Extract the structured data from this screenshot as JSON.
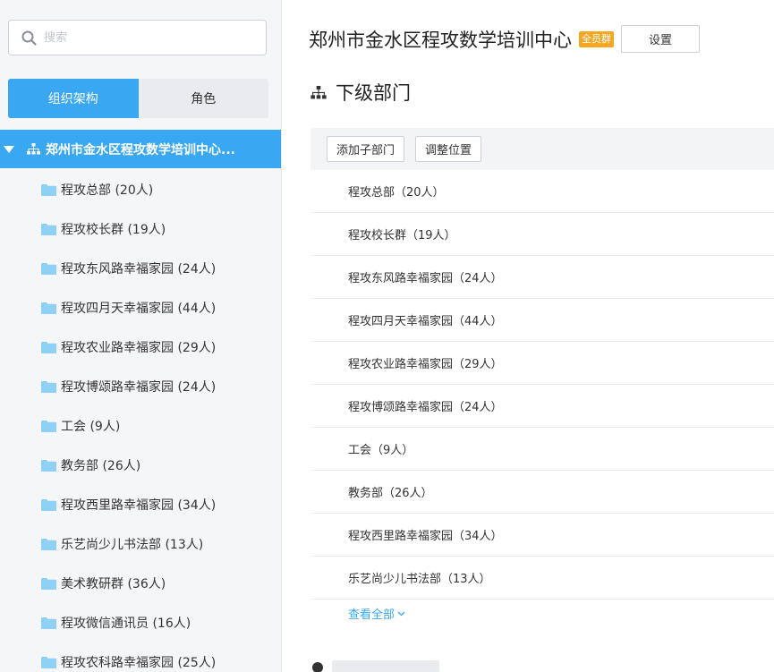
{
  "sidebar": {
    "search_placeholder": "搜索",
    "tabs": [
      {
        "label": "组织架构",
        "active": true
      },
      {
        "label": "角色",
        "active": false
      }
    ],
    "root": {
      "name": "郑州市金水区程攻数学培训中心..."
    },
    "items": [
      {
        "label": "程攻总部 (20人)"
      },
      {
        "label": "程攻校长群 (19人)"
      },
      {
        "label": "程攻东风路幸福家园 (24人)"
      },
      {
        "label": "程攻四月天幸福家园 (44人)"
      },
      {
        "label": "程攻农业路幸福家园 (29人)"
      },
      {
        "label": "程攻博颂路幸福家园 (24人)"
      },
      {
        "label": "工会 (9人)"
      },
      {
        "label": "教务部 (26人)"
      },
      {
        "label": "程攻西里路幸福家园 (34人)"
      },
      {
        "label": "乐艺尚少儿书法部 (13人)"
      },
      {
        "label": "美术教研群 (36人)"
      },
      {
        "label": "程攻微信通讯员 (16人)"
      },
      {
        "label": "程攻农科路幸福家园 (25人)"
      }
    ]
  },
  "main": {
    "title": "郑州市金水区程攻数学培训中心",
    "badge": "全员群",
    "settings_label": "设置",
    "section_title": "下级部门",
    "toolbar": {
      "add_child_label": "添加子部门",
      "adjust_position_label": "调整位置"
    },
    "departments": [
      {
        "label": "程攻总部（20人）"
      },
      {
        "label": "程攻校长群（19人）"
      },
      {
        "label": "程攻东风路幸福家园（24人）"
      },
      {
        "label": "程攻四月天幸福家园（44人）"
      },
      {
        "label": "程攻农业路幸福家园（29人）"
      },
      {
        "label": "程攻博颂路幸福家园（24人）"
      },
      {
        "label": "工会（9人）"
      },
      {
        "label": "教务部（26人）"
      },
      {
        "label": "程攻西里路幸福家园（34人）"
      },
      {
        "label": "乐艺尚少儿书法部（13人）"
      }
    ],
    "view_all_label": "查看全部"
  },
  "colors": {
    "accent": "#3aa7f2",
    "badge": "#f5a623",
    "folder": "#8fd0f7",
    "sidebar_bg": "#f5f6f8"
  },
  "icons": {
    "search": "search-icon",
    "root_caret": "caret-down-icon",
    "root_org": "org-chart-icon",
    "folder": "folder-icon",
    "section": "org-chart-icon",
    "view_all": "chevron-down-icon"
  }
}
